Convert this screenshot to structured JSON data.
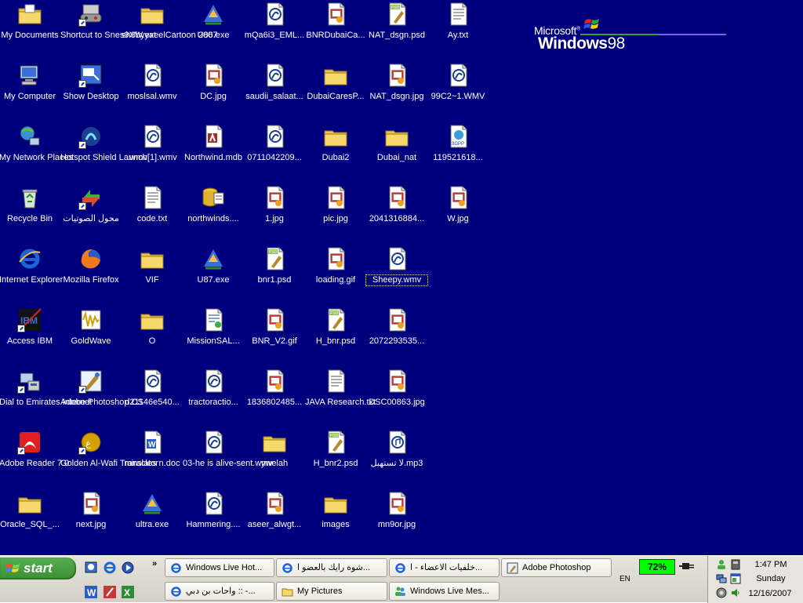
{
  "desktop": {
    "background": "#00007e",
    "logo": {
      "brand": "Microsoft",
      "reg": "®",
      "product": "Windows",
      "version": "98"
    },
    "icons": [
      {
        "label": "My Documents",
        "icon": "folder-docs-icon",
        "col": 0,
        "row": 0
      },
      {
        "label": "My Computer",
        "icon": "computer-icon",
        "col": 0,
        "row": 1
      },
      {
        "label": "My Network Places",
        "icon": "network-icon",
        "col": 0,
        "row": 2
      },
      {
        "label": "Recycle Bin",
        "icon": "recycle-bin-icon",
        "col": 0,
        "row": 3
      },
      {
        "label": "Internet Explorer",
        "icon": "ie-icon",
        "col": 0,
        "row": 4
      },
      {
        "label": "Access IBM",
        "icon": "ibm-icon",
        "col": 0,
        "row": 5
      },
      {
        "label": "Dial to Emirates Internet",
        "icon": "dialup-icon",
        "col": 0,
        "row": 6
      },
      {
        "label": "Adobe Reader 7.0",
        "icon": "acrobat-icon",
        "col": 0,
        "row": 7
      },
      {
        "label": "Oracle_SQL_...",
        "icon": "folder-icon",
        "col": 0,
        "row": 8
      },
      {
        "label": "Shortcut to Snes9XW.exe",
        "icon": "gamepad-icon",
        "col": 1,
        "row": 0
      },
      {
        "label": "Show Desktop",
        "icon": "show-desktop-icon",
        "col": 1,
        "row": 1
      },
      {
        "label": "Hotspot Shield Launch",
        "icon": "hotspot-icon",
        "col": 1,
        "row": 2
      },
      {
        "label": "محول الصوتيات",
        "icon": "converter-icon",
        "col": 1,
        "row": 3
      },
      {
        "label": "Mozilla Firefox",
        "icon": "firefox-icon",
        "col": 1,
        "row": 4
      },
      {
        "label": "GoldWave",
        "icon": "goldwave-icon",
        "col": 1,
        "row": 5
      },
      {
        "label": "Adobe Photoshop CS",
        "icon": "photoshop-icon",
        "col": 1,
        "row": 6
      },
      {
        "label": "Golden Al-Wafi Translator",
        "icon": "translator-icon",
        "col": 1,
        "row": 7
      },
      {
        "label": "next.jpg",
        "icon": "image-file-icon",
        "col": 1,
        "row": 8
      },
      {
        "label": "sh3byyat elCartoon 2007",
        "icon": "folder-icon",
        "col": 2,
        "row": 0
      },
      {
        "label": "moslsal.wmv",
        "icon": "video-file-icon",
        "col": 2,
        "row": 1
      },
      {
        "label": ".wmv[1].wmv",
        "icon": "video-file-icon",
        "col": 2,
        "row": 2
      },
      {
        "label": "code.txt",
        "icon": "text-file-icon",
        "col": 2,
        "row": 3
      },
      {
        "label": "VIF",
        "icon": "folder-icon",
        "col": 2,
        "row": 4
      },
      {
        "label": "O",
        "icon": "folder-icon",
        "col": 2,
        "row": 5
      },
      {
        "label": "d21146e540...",
        "icon": "video-file-icon",
        "col": 2,
        "row": 6
      },
      {
        "label": "miracles n.doc",
        "icon": "word-file-icon",
        "col": 2,
        "row": 7
      },
      {
        "label": "ultra.exe",
        "icon": "exe-icon",
        "col": 2,
        "row": 8
      },
      {
        "label": "U86.exe",
        "icon": "exe-icon",
        "col": 3,
        "row": 0
      },
      {
        "label": "DC.jpg",
        "icon": "image-file-icon",
        "col": 3,
        "row": 1
      },
      {
        "label": "Northwind.mdb",
        "icon": "access-file-icon",
        "col": 3,
        "row": 2
      },
      {
        "label": "northwinds....",
        "icon": "database-icon",
        "col": 3,
        "row": 3
      },
      {
        "label": "U87.exe",
        "icon": "exe-icon",
        "col": 3,
        "row": 4
      },
      {
        "label": "MissionSAL...",
        "icon": "document-icon",
        "col": 3,
        "row": 5
      },
      {
        "label": "tractoractio...",
        "icon": "video-file-icon",
        "col": 3,
        "row": 6
      },
      {
        "label": "03-he is alive-sent.wmv",
        "icon": "video-file-icon",
        "col": 3,
        "row": 7
      },
      {
        "label": "Hammering....",
        "icon": "video-file-icon",
        "col": 3,
        "row": 8
      },
      {
        "label": "mQa6i3_EML...",
        "icon": "video-file-icon",
        "col": 4,
        "row": 0
      },
      {
        "label": "saudii_salaat...",
        "icon": "video-file-icon",
        "col": 4,
        "row": 1
      },
      {
        "label": "0711042209...",
        "icon": "video-file-icon",
        "col": 4,
        "row": 2
      },
      {
        "label": "1.jpg",
        "icon": "image-file-icon",
        "col": 4,
        "row": 3
      },
      {
        "label": "bnr1.psd",
        "icon": "psd-file-icon",
        "col": 4,
        "row": 4
      },
      {
        "label": "BNR_V2.gif",
        "icon": "image-file-icon",
        "col": 4,
        "row": 5
      },
      {
        "label": "1836802485...",
        "icon": "image-file-icon",
        "col": 4,
        "row": 6
      },
      {
        "label": "ywelah",
        "icon": "folder-icon",
        "col": 4,
        "row": 7
      },
      {
        "label": "aseer_alwgt...",
        "icon": "image-file-icon",
        "col": 4,
        "row": 8
      },
      {
        "label": "BNRDubaiCa...",
        "icon": "image-file-icon",
        "col": 5,
        "row": 0
      },
      {
        "label": "DubaiCaresP...",
        "icon": "folder-icon",
        "col": 5,
        "row": 1
      },
      {
        "label": "Dubai2",
        "icon": "folder-icon",
        "col": 5,
        "row": 2
      },
      {
        "label": "pic.jpg",
        "icon": "image-file-icon",
        "col": 5,
        "row": 3
      },
      {
        "label": "loading.gif",
        "icon": "image-file-icon",
        "col": 5,
        "row": 4
      },
      {
        "label": "H_bnr.psd",
        "icon": "psd-file-icon",
        "col": 5,
        "row": 5
      },
      {
        "label": "JAVA Research.txt",
        "icon": "text-file-icon",
        "col": 5,
        "row": 6
      },
      {
        "label": "H_bnr2.psd",
        "icon": "psd-file-icon",
        "col": 5,
        "row": 7
      },
      {
        "label": "images",
        "icon": "folder-icon",
        "col": 5,
        "row": 8
      },
      {
        "label": "NAT_dsgn.psd",
        "icon": "psd-file-icon",
        "col": 6,
        "row": 0
      },
      {
        "label": "NAT_dsgn.jpg",
        "icon": "image-file-icon",
        "col": 6,
        "row": 1
      },
      {
        "label": "Dubai_nat",
        "icon": "folder-icon",
        "col": 6,
        "row": 2
      },
      {
        "label": "2041316884...",
        "icon": "image-file-icon",
        "col": 6,
        "row": 3
      },
      {
        "label": "Sheepy.wmv",
        "icon": "video-file-icon",
        "col": 6,
        "row": 4,
        "selected": true
      },
      {
        "label": "2072293535...",
        "icon": "image-file-icon",
        "col": 6,
        "row": 5
      },
      {
        "label": "DSC00863.jpg",
        "icon": "image-file-icon",
        "col": 6,
        "row": 6
      },
      {
        "label": "لا تستهبل.mp3",
        "icon": "audio-file-icon",
        "col": 6,
        "row": 7
      },
      {
        "label": "mn9or.jpg",
        "icon": "image-file-icon",
        "col": 6,
        "row": 8
      },
      {
        "label": "Ay.txt",
        "icon": "text-file-icon",
        "col": 7,
        "row": 0
      },
      {
        "label": "99C2~1.WMV",
        "icon": "video-file-icon",
        "col": 7,
        "row": 1
      },
      {
        "label": "119521618...",
        "icon": "3gp-file-icon",
        "col": 7,
        "row": 2
      },
      {
        "label": "W.jpg",
        "icon": "image-file-icon",
        "col": 7,
        "row": 3
      }
    ]
  },
  "taskbar": {
    "start_label": "start",
    "chevron": "»",
    "buttons_row1": [
      {
        "label": "Windows Live Hot...",
        "icon": "ie-icon"
      },
      {
        "label": "شوه رايك بالعضو ا...",
        "icon": "ie-icon"
      },
      {
        "label": "خلفيات الاعضاء - ا...",
        "icon": "ie-icon"
      },
      {
        "label": "Adobe Photoshop",
        "icon": "photoshop-icon"
      }
    ],
    "buttons_row2": [
      {
        "label": "واحات بن دبي :: -...",
        "icon": "ie-icon"
      },
      {
        "label": "My Pictures",
        "icon": "folder-icon"
      },
      {
        "label": "Windows Live Mes...",
        "icon": "messenger-icon"
      }
    ],
    "lang": "EN",
    "battery": "72%",
    "clock": {
      "time": "1:47 PM",
      "day": "Sunday",
      "date": "12/16/2007"
    }
  }
}
